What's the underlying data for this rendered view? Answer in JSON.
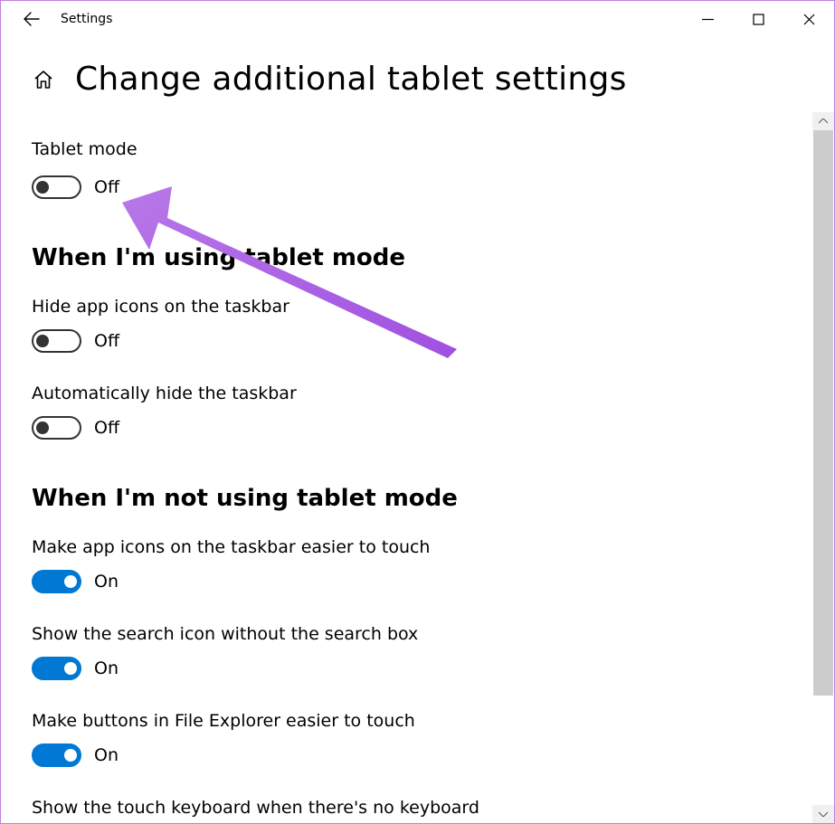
{
  "app_title": "Settings",
  "page_title": "Change additional tablet settings",
  "toggle_labels": {
    "on": "On",
    "off": "Off"
  },
  "sections": {
    "tablet_mode": {
      "title": "Tablet mode",
      "state": "off"
    },
    "using_tablet": {
      "title": "When I'm using tablet mode",
      "hide_icons": {
        "label": "Hide app icons on the taskbar",
        "state": "off"
      },
      "auto_hide_taskbar": {
        "label": "Automatically hide the taskbar",
        "state": "off"
      }
    },
    "not_using_tablet": {
      "title": "When I'm not using tablet mode",
      "easier_icons": {
        "label": "Make app icons on the taskbar easier to touch",
        "state": "on"
      },
      "search_icon": {
        "label": "Show the search icon without the search box",
        "state": "on"
      },
      "explorer_buttons": {
        "label": "Make buttons in File Explorer easier to touch",
        "state": "on"
      },
      "touch_keyboard": {
        "label": "Show the touch keyboard when there's no keyboard"
      }
    }
  }
}
